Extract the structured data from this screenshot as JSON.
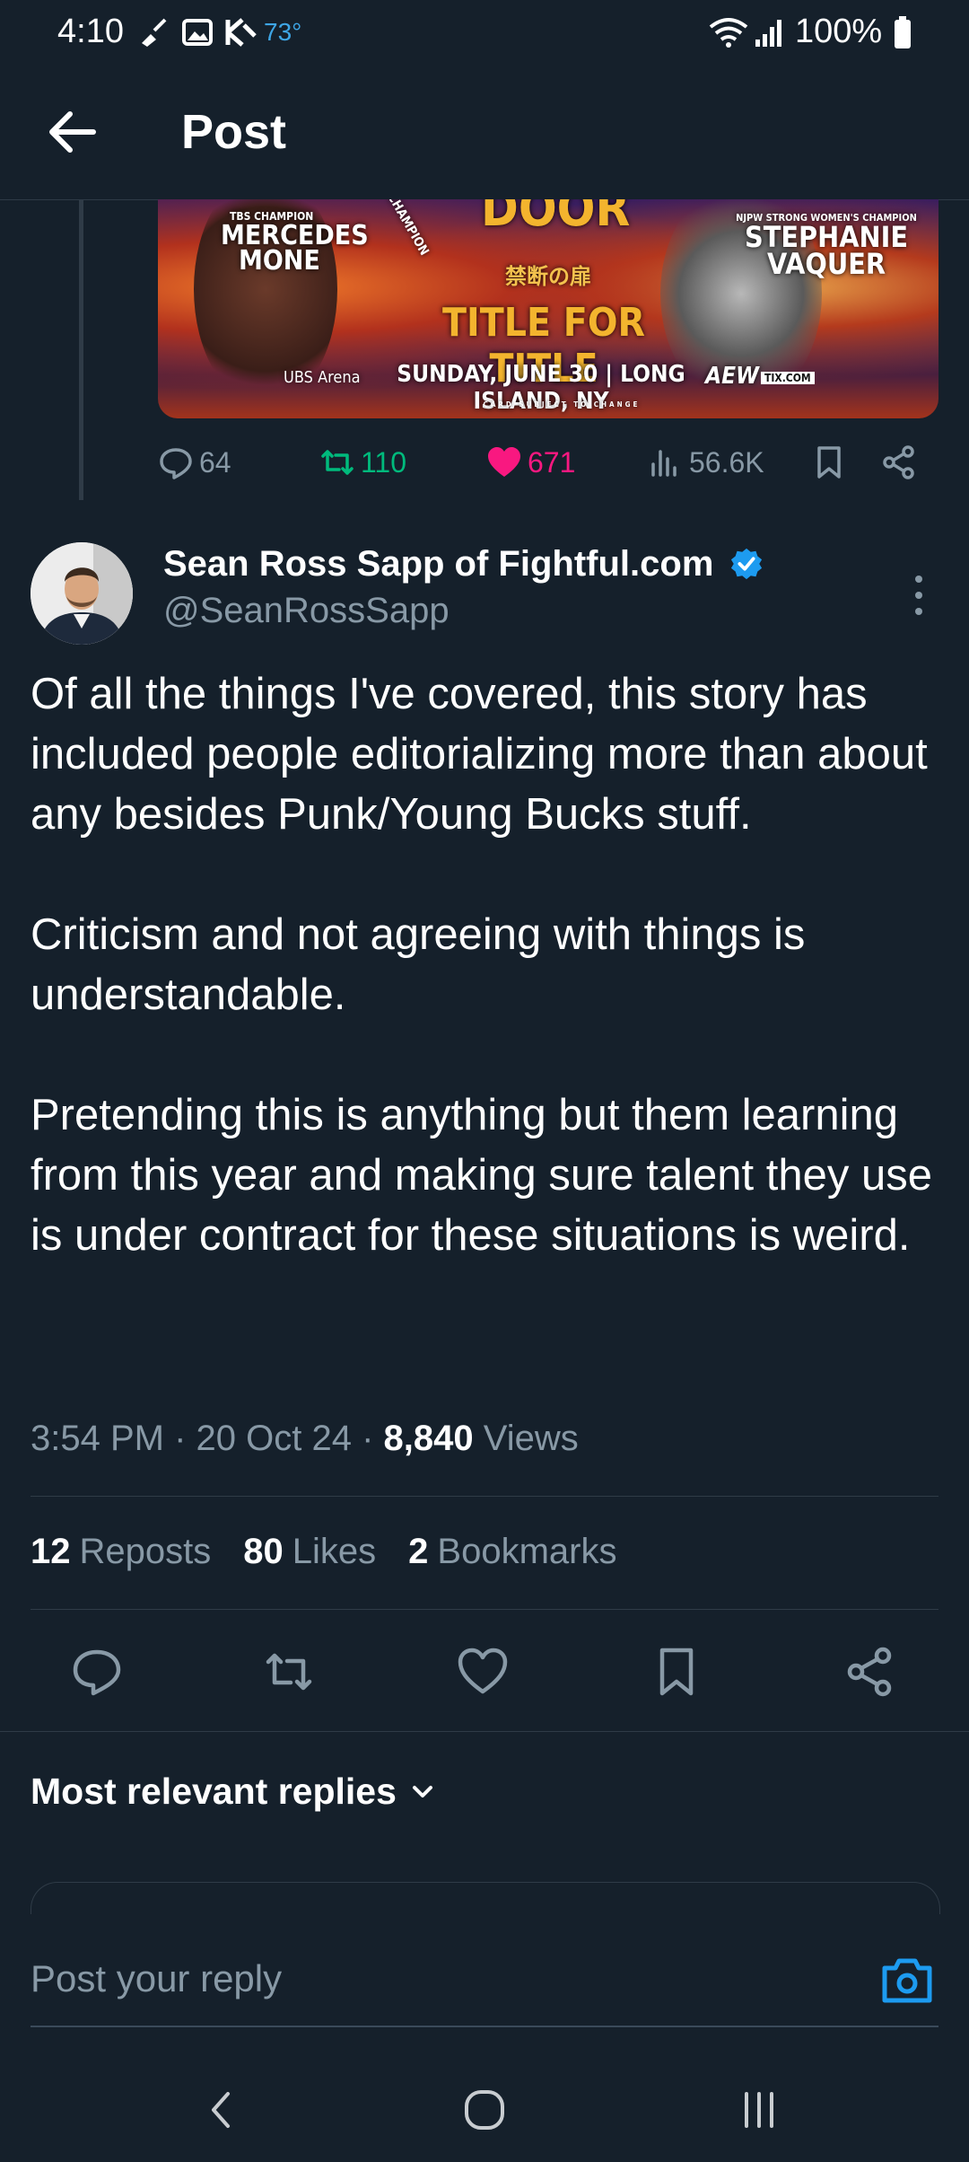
{
  "status_bar": {
    "time": "4:10",
    "temperature": "73°",
    "battery": "100%"
  },
  "header": {
    "title": "Post"
  },
  "quoted_post": {
    "banner": {
      "left_title": "TBS CHAMPION",
      "left_name_1": "MERCEDES",
      "left_name_2": "MONE",
      "belt_text": "CHAMPION",
      "center_title": "DOOR",
      "japanese": "禁断の扉",
      "match": "TITLE FOR TITLE",
      "right_title": "NJPW STRONG WOMEN'S CHAMPION",
      "right_name_1": "STEPHANIE",
      "right_name_2": "VAQUER",
      "venue": "UBS Arena",
      "date_place": "SUNDAY, JUNE 30 | LONG ISLAND, NY",
      "brand": "AEW",
      "tix": "TIX.COM",
      "fine_print": "CARD SUBJECT TO CHANGE"
    },
    "replies": "64",
    "reposts": "110",
    "likes": "671",
    "views": "56.6K"
  },
  "post": {
    "display_name": "Sean Ross Sapp of Fightful.com",
    "handle": "@SeanRossSapp",
    "body": "Of all the things I've covered, this story has included people editorializing more than about any besides Punk/Young Bucks stuff.\n\nCriticism and not agreeing with things is understandable.\n\nPretending this is anything but them learning from this year and making sure talent they use is under contract for these situations is weird.",
    "time": "3:54 PM",
    "date": "20 Oct 24",
    "views_count": "8,840",
    "views_label": "Views",
    "reposts_count": "12",
    "reposts_label": "Reposts",
    "likes_count": "80",
    "likes_label": "Likes",
    "bookmarks_count": "2",
    "bookmarks_label": "Bookmarks"
  },
  "replies_section": {
    "sort_label": "Most relevant replies"
  },
  "reply_bar": {
    "placeholder": "Post your reply"
  },
  "colors": {
    "background": "#15202b",
    "accent": "#1d9bf0",
    "like": "#f91880",
    "repost": "#00ba7c",
    "muted": "#8899a6"
  }
}
